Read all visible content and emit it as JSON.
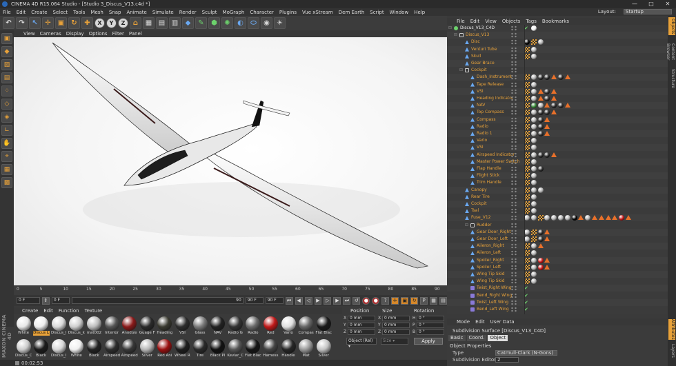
{
  "window": {
    "title": "CINEMA 4D R15.064 Studio - [Studio 3_Discus_V13.c4d *]",
    "controls": [
      "—",
      "□",
      "✕"
    ]
  },
  "menubar": [
    "File",
    "Edit",
    "Create",
    "Select",
    "Tools",
    "Mesh",
    "Snap",
    "Animate",
    "Simulate",
    "Render",
    "Sculpt",
    "MoGraph",
    "Character",
    "Plugins",
    "Vue xStream",
    "Dem Earth",
    "Script",
    "Window",
    "Help"
  ],
  "layout": {
    "label": "Layout:",
    "value": "Startup"
  },
  "toolbar": {
    "axis_buttons": [
      "X",
      "Y",
      "Z"
    ]
  },
  "viewport_menu": [
    "View",
    "Cameras",
    "Display",
    "Options",
    "Filter",
    "Panel"
  ],
  "timeline": {
    "ticks": [
      "0",
      "5",
      "10",
      "15",
      "20",
      "25",
      "30",
      "35",
      "40",
      "45",
      "50",
      "55",
      "60",
      "65",
      "70",
      "75",
      "80",
      "85",
      "90"
    ],
    "current": "0 F"
  },
  "transport": {
    "start": "0 F",
    "preview_start": "0 F",
    "preview_end": "90 F",
    "end": "90 F",
    "slider_value": "90"
  },
  "material_menu": [
    "Create",
    "Edit",
    "Function",
    "Texture"
  ],
  "materials": {
    "row1": [
      {
        "name": "White",
        "color": "#e8e8e8",
        "selected": false
      },
      {
        "name": "Discus L",
        "color": "#eeeeee",
        "selected": true
      },
      {
        "name": "Discus_l",
        "color": "#dadada",
        "selected": false
      },
      {
        "name": "Discus_k",
        "color": "#cfcfcf",
        "selected": false
      },
      {
        "name": "mat002",
        "color": "#bdbdbd",
        "selected": false
      },
      {
        "name": "Interior",
        "color": "#555555",
        "selected": false
      },
      {
        "name": "Anodize",
        "color": "#8a1a1a",
        "selected": false
      },
      {
        "name": "Guage F",
        "color": "#2a2a2a",
        "selected": false
      },
      {
        "name": "Heading",
        "color": "#3a3a30",
        "selected": false
      },
      {
        "name": "VSI",
        "color": "#2d2d2d",
        "selected": false
      },
      {
        "name": "Glass",
        "color": "#7a7a7a",
        "selected": false
      },
      {
        "name": "NAV",
        "color": "#222222",
        "selected": false
      },
      {
        "name": "Radio G",
        "color": "#333333",
        "selected": false
      },
      {
        "name": "Radio",
        "color": "#6a6a6a",
        "selected": false
      },
      {
        "name": "Red",
        "color": "#c01818",
        "selected": false
      },
      {
        "name": "Vario",
        "color": "#e0e0e0",
        "selected": false
      },
      {
        "name": "Compas",
        "color": "#666666",
        "selected": false
      },
      {
        "name": "Flat Blac",
        "color": "#1a1a1a",
        "selected": false
      }
    ],
    "row2": [
      {
        "name": "Discus_C",
        "color": "#cccccc",
        "selected": false
      },
      {
        "name": "Black",
        "color": "#1c1c1c",
        "selected": false
      },
      {
        "name": "Discus_l",
        "color": "#d8d8d8",
        "selected": false
      },
      {
        "name": "White",
        "color": "#f0f0f0",
        "selected": false
      },
      {
        "name": "Black",
        "color": "#222222",
        "selected": false
      },
      {
        "name": "Airspeed",
        "color": "#2e2e2e",
        "selected": false
      },
      {
        "name": "Airspeed",
        "color": "#383838",
        "selected": false
      },
      {
        "name": "Silver",
        "color": "#b8b8b8",
        "selected": false
      },
      {
        "name": "Red Ani",
        "color": "#9a1010",
        "selected": false
      },
      {
        "name": "Wheel R",
        "color": "#1e1e1e",
        "selected": false
      },
      {
        "name": "Tire",
        "color": "#2a2a2a",
        "selected": false
      },
      {
        "name": "Black Pl",
        "color": "#111111",
        "selected": false
      },
      {
        "name": "Kevlar_C",
        "color": "#555555",
        "selected": false
      },
      {
        "name": "Flat Blac",
        "color": "#151515",
        "selected": false
      },
      {
        "name": "Harness",
        "color": "#444444",
        "selected": false
      },
      {
        "name": "Handle",
        "color": "#262626",
        "selected": false
      },
      {
        "name": "Mat",
        "color": "#9a9a9a",
        "selected": false
      },
      {
        "name": "Silver",
        "color": "#c4c4c4",
        "selected": false
      }
    ]
  },
  "coords": {
    "headers": [
      "Position",
      "Size",
      "Rotation"
    ],
    "rows": [
      {
        "axis": "X",
        "pos": "0 mm",
        "size": "0 mm",
        "rot_label": "H",
        "rot": "0 °"
      },
      {
        "axis": "Y",
        "pos": "0 mm",
        "size": "0 mm",
        "rot_label": "P",
        "rot": "0 °"
      },
      {
        "axis": "Z",
        "pos": "0 mm",
        "size": "0 mm",
        "rot_label": "B",
        "rot": "0 °"
      }
    ],
    "mode": "Object (Rel) ▾",
    "size_mode": "Size ▾",
    "apply": "Apply"
  },
  "status": {
    "time": "00:02:53"
  },
  "object_menu": [
    "File",
    "Edit",
    "View",
    "Objects",
    "Tags",
    "Bookmarks"
  ],
  "objects": [
    {
      "name": "Discus_V13_C4D",
      "depth": 0,
      "icon": "subdivision",
      "root": true,
      "tags": [
        "check-green",
        "sphere-white"
      ]
    },
    {
      "name": "Discus_V13",
      "depth": 1,
      "icon": "null",
      "tags": []
    },
    {
      "name": "Disc",
      "depth": 2,
      "icon": "poly",
      "tags": [
        "sphere-black",
        "checker",
        "sphere-gray"
      ]
    },
    {
      "name": "Venturi Tube",
      "depth": 2,
      "icon": "poly",
      "tags": [
        "checker",
        "sphere-gray"
      ]
    },
    {
      "name": "Skull",
      "depth": 2,
      "icon": "poly",
      "tags": [
        "checker",
        "sphere-gray"
      ]
    },
    {
      "name": "Gear Brace",
      "depth": 2,
      "icon": "poly",
      "tags": []
    },
    {
      "name": "Cockpit",
      "depth": 2,
      "icon": "null",
      "tags": []
    },
    {
      "name": "Dash_Instrument",
      "depth": 3,
      "icon": "poly",
      "tags": [
        "checker",
        "sphere-gray",
        "sphere-dark",
        "sphere-dark",
        "tri-orange",
        "sphere-dark",
        "tri-orange"
      ]
    },
    {
      "name": "Tape Release",
      "depth": 3,
      "icon": "poly",
      "tags": [
        "checker",
        "sphere-gray"
      ]
    },
    {
      "name": "VSI",
      "depth": 3,
      "icon": "poly",
      "tags": [
        "checker",
        "sphere-gray",
        "tri-orange",
        "sphere-dark",
        "tri-orange"
      ]
    },
    {
      "name": "Heading Indicator",
      "depth": 3,
      "icon": "poly",
      "tags": [
        "checker",
        "sphere-gray",
        "tri-orange",
        "sphere-dark",
        "tri-orange"
      ]
    },
    {
      "name": "NAV",
      "depth": 3,
      "icon": "poly",
      "tags": [
        "checker",
        "sphere-green",
        "sphere-gray",
        "tri-orange",
        "sphere-dark",
        "sphere-dark",
        "tri-orange"
      ]
    },
    {
      "name": "Top Compass",
      "depth": 3,
      "icon": "poly",
      "tags": [
        "checker",
        "sphere-gray",
        "sphere-dark",
        "sphere-dark",
        "tri-orange"
      ]
    },
    {
      "name": "Compass",
      "depth": 3,
      "icon": "poly",
      "tags": [
        "checker",
        "sphere-gray",
        "sphere-dark",
        "tri-orange"
      ]
    },
    {
      "name": "Radio",
      "depth": 3,
      "icon": "poly",
      "tags": [
        "checker",
        "sphere-gray",
        "sphere-dark",
        "tri-orange"
      ]
    },
    {
      "name": "Radio 1",
      "depth": 3,
      "icon": "poly",
      "tags": [
        "checker",
        "sphere-gray",
        "sphere-dark",
        "tri-orange"
      ]
    },
    {
      "name": "Vario",
      "depth": 3,
      "icon": "poly",
      "tags": [
        "checker",
        "sphere-gray"
      ]
    },
    {
      "name": "VSI",
      "depth": 3,
      "icon": "poly",
      "tags": [
        "checker",
        "sphere-gray"
      ]
    },
    {
      "name": "Airspeed Indicator",
      "depth": 3,
      "icon": "poly",
      "tags": [
        "checker",
        "sphere-gray",
        "sphere-dark",
        "sphere-dark",
        "tri-orange"
      ]
    },
    {
      "name": "Master Power Switch",
      "depth": 3,
      "icon": "poly",
      "tags": [
        "checker",
        "sphere-gray"
      ]
    },
    {
      "name": "Flap Handle",
      "depth": 3,
      "icon": "poly",
      "tags": [
        "checker",
        "sphere-gray",
        "sphere-dark"
      ]
    },
    {
      "name": "Flight Stick",
      "depth": 3,
      "icon": "poly",
      "tags": [
        "checker",
        "sphere-gray"
      ]
    },
    {
      "name": "Trim Handle",
      "depth": 3,
      "icon": "poly",
      "tags": [
        "checker",
        "sphere-gray"
      ]
    },
    {
      "name": "Canopy",
      "depth": 2,
      "icon": "poly",
      "tags": [
        "checker",
        "sphere-gray",
        "sphere-gray"
      ]
    },
    {
      "name": "Rear Tire",
      "depth": 2,
      "icon": "poly",
      "tags": [
        "checker",
        "sphere-gray"
      ]
    },
    {
      "name": "Cockpit",
      "depth": 2,
      "icon": "poly",
      "tags": [
        "checker",
        "sphere-gray"
      ]
    },
    {
      "name": "Tsal",
      "depth": 2,
      "icon": "poly",
      "tags": [
        "checker",
        "sphere-gray"
      ]
    },
    {
      "name": "Fuse_V12",
      "depth": 2,
      "icon": "poly",
      "tags": [
        "sphere-gray",
        "sphere-gray",
        "checker",
        "sphere-gray",
        "sphere-gray",
        "sphere-gray",
        "sphere-gray",
        "sphere-black",
        "tri-orange",
        "sphere-gray",
        "tri-orange",
        "tri-orange",
        "tri-orange",
        "tri-orange",
        "sphere-red",
        "tri-orange"
      ]
    },
    {
      "name": "Rudder",
      "depth": 3,
      "icon": "null",
      "tags": []
    },
    {
      "name": "Gear Door_Right",
      "depth": 3,
      "icon": "poly",
      "tags": [
        "sphere-gray",
        "checker",
        "sphere-dark",
        "tri-orange"
      ]
    },
    {
      "name": "Gear Door_Left",
      "depth": 3,
      "icon": "poly",
      "tags": [
        "sphere-gray",
        "checker",
        "sphere-dark",
        "tri-orange"
      ]
    },
    {
      "name": "Aileron_Right",
      "depth": 3,
      "icon": "poly",
      "tags": [
        "checker",
        "sphere-gray",
        "tri-orange"
      ]
    },
    {
      "name": "Aileron_Left",
      "depth": 3,
      "icon": "poly",
      "tags": [
        "checker",
        "sphere-gray"
      ]
    },
    {
      "name": "Spoiler_Right",
      "depth": 3,
      "icon": "poly",
      "tags": [
        "checker",
        "sphere-gray",
        "sphere-red",
        "tri-orange"
      ]
    },
    {
      "name": "Spoiler_Left",
      "depth": 3,
      "icon": "poly",
      "tags": [
        "checker",
        "sphere-gray",
        "sphere-red",
        "tri-orange"
      ]
    },
    {
      "name": "Wing Tip Skid",
      "depth": 3,
      "icon": "poly",
      "tags": [
        "checker",
        "sphere-gray"
      ]
    },
    {
      "name": "Wing Tip Skid",
      "depth": 3,
      "icon": "poly",
      "tags": [
        "checker",
        "sphere-gray"
      ]
    },
    {
      "name": "Twist_Right Wing",
      "depth": 3,
      "icon": "deformer",
      "tags": [
        "check-green"
      ]
    },
    {
      "name": "Bend_Right Wing",
      "depth": 3,
      "icon": "deformer",
      "tags": [
        "check-green"
      ]
    },
    {
      "name": "Twist_Left Wing",
      "depth": 3,
      "icon": "deformer",
      "tags": [
        "check-green"
      ]
    },
    {
      "name": "Bend_Left Wing",
      "depth": 3,
      "icon": "deformer",
      "tags": [
        "check-green"
      ]
    }
  ],
  "attr_menu": [
    "Mode",
    "Edit",
    "User Data"
  ],
  "attributes": {
    "title": "Subdivision Surface [Discus_V13_C4D]",
    "tabs": [
      "Basic",
      "Coord.",
      "Object"
    ],
    "active_tab": "Object",
    "section": "Object Properties",
    "type_label": "Type",
    "type_value": "Catmull-Clark (N-Gons)",
    "editor_label": "Subdivision Editor",
    "editor_value": "2"
  },
  "side_tabs": [
    "Objects",
    "Content Browser",
    "Structure"
  ],
  "side_tabs_bottom": [
    "Attributes",
    "Layers"
  ],
  "colors": {
    "accent": "#e8a23a",
    "panel": "#3b3b3b",
    "viewport_bg": "#f4f4f4"
  }
}
